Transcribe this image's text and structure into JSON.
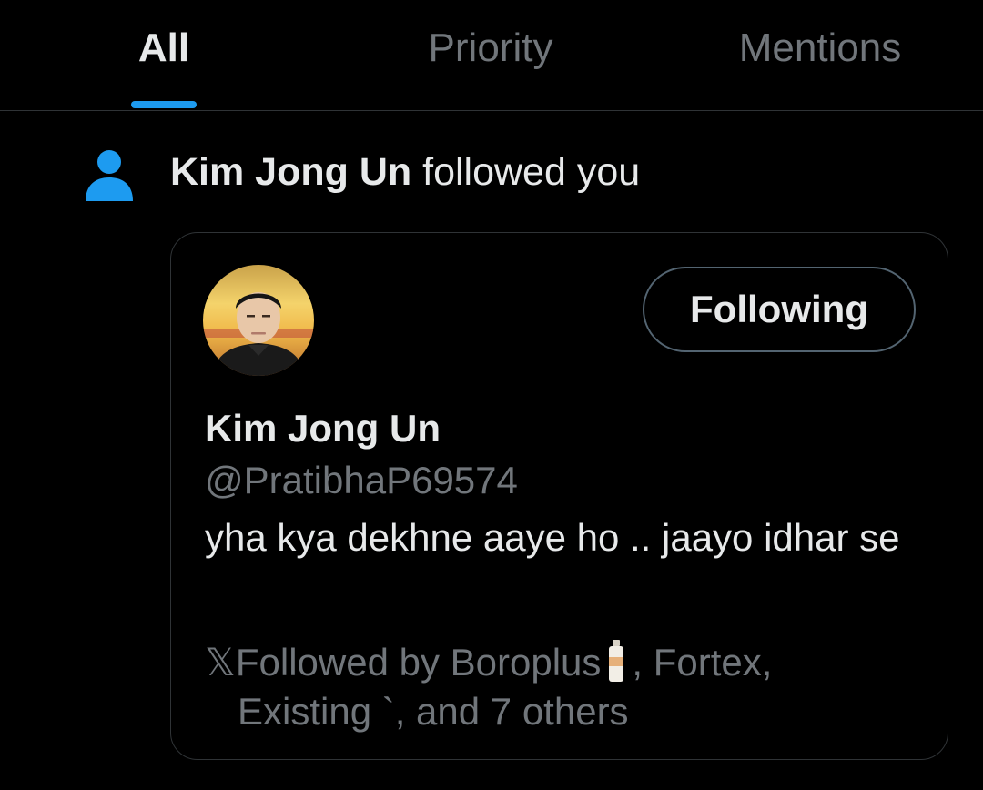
{
  "tabs": [
    {
      "label": "All",
      "active": true
    },
    {
      "label": "Priority",
      "active": false
    },
    {
      "label": "Mentions",
      "active": false
    }
  ],
  "notification": {
    "icon": "person-icon",
    "actor": "Kim Jong Un",
    "action": "followed you"
  },
  "profile_card": {
    "display_name": "Kim Jong Un",
    "handle": "@PratibhaP69574",
    "bio": "yha kya dekhne aaye ho .. jaayo idhar se",
    "follow_button_label": "Following",
    "followed_by": {
      "prefix_glyph": "𝕏",
      "prefix": "Followed by Boroplus",
      "emoji": "bottle-icon",
      "middle": ", Fortex,",
      "line2": "Existing `, and 7 others"
    }
  },
  "colors": {
    "accent": "#1d9bf0",
    "background": "#000000",
    "text_primary": "#e7e9ea",
    "text_secondary": "#71767b",
    "border": "#2f3336"
  }
}
